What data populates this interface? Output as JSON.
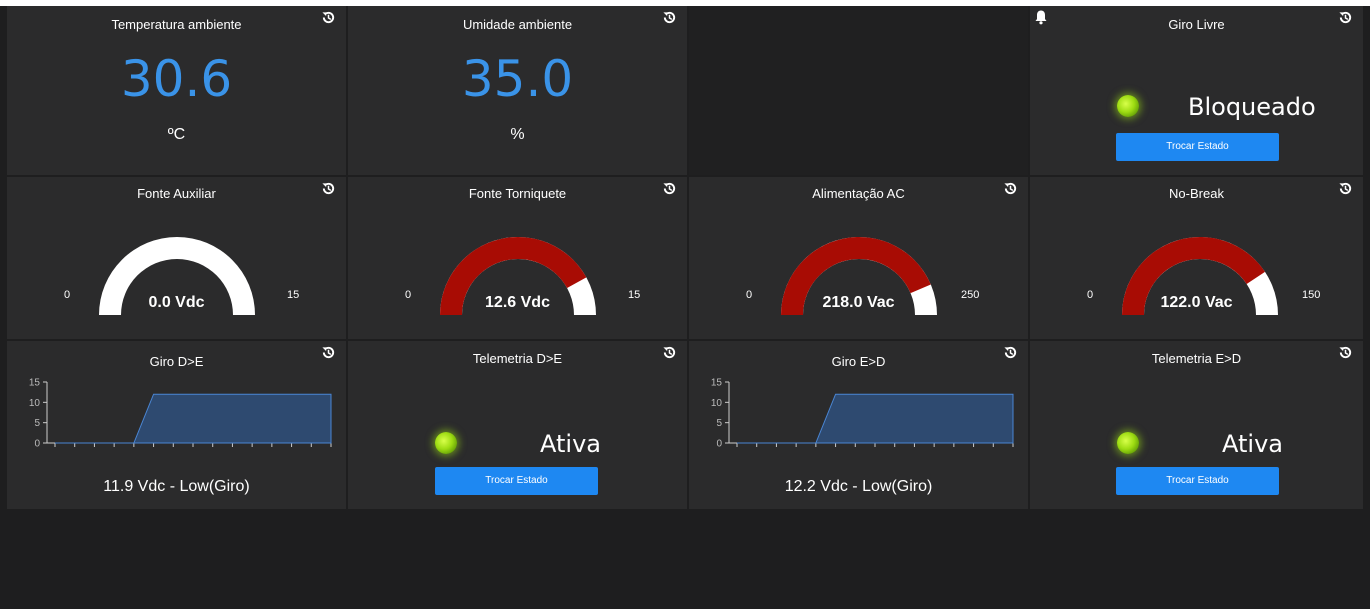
{
  "colors": {
    "value_blue": "#3a93e8",
    "gauge_red": "#a80c04",
    "gauge_track": "#ffffff",
    "led_green": "#9ddc12",
    "button_blue": "#1e88f2",
    "chart_fill": "#2e4a70",
    "chart_line": "#4a86d4"
  },
  "icons": {
    "history": "history-icon",
    "alarm": "bell-icon"
  },
  "tiles": {
    "temperatura": {
      "title": "Temperatura ambiente",
      "value": "30.6",
      "unit": "ºC"
    },
    "umidade": {
      "title": "Umidade ambiente",
      "value": "35.0",
      "unit": "%"
    },
    "giro_livre": {
      "title": "Giro Livre",
      "state": "Bloqueado",
      "button": "Trocar Estado"
    },
    "fonte_auxiliar": {
      "title": "Fonte Auxiliar",
      "min": "0",
      "max": "15",
      "value": 0.0,
      "value_label": "0.0 Vdc"
    },
    "fonte_torniquete": {
      "title": "Fonte Torniquete",
      "min": "0",
      "max": "15",
      "value": 12.6,
      "value_label": "12.6 Vdc"
    },
    "alimentacao_ac": {
      "title": "Alimentação AC",
      "min": "0",
      "max": "250",
      "value": 218.0,
      "value_label": "218.0 Vac"
    },
    "no_break": {
      "title": "No-Break",
      "min": "0",
      "max": "150",
      "value": 122.0,
      "value_label": "122.0 Vac"
    },
    "giro_de": {
      "title": "Giro D>E",
      "label": "11.9 Vdc - Low(Giro)"
    },
    "telemetria_de": {
      "title": "Telemetria D>E",
      "state": "Ativa",
      "button": "Trocar Estado"
    },
    "giro_ed": {
      "title": "Giro E>D",
      "label": "12.2 Vdc - Low(Giro)"
    },
    "telemetria_ed": {
      "title": "Telemetria E>D",
      "state": "Ativa",
      "button": "Trocar Estado"
    }
  },
  "chart_data": [
    {
      "type": "area",
      "ylim": [
        0,
        15
      ],
      "yticks": [
        "0",
        "5",
        "10",
        "15"
      ],
      "x": [
        0,
        1,
        2,
        3,
        4,
        5,
        6,
        7,
        8,
        9,
        10,
        11,
        12,
        13,
        14
      ],
      "values": [
        0,
        0,
        0,
        0,
        0,
        12,
        12,
        12,
        12,
        12,
        12,
        12,
        12,
        12,
        12
      ]
    },
    {
      "type": "area",
      "ylim": [
        0,
        15
      ],
      "yticks": [
        "0",
        "5",
        "10",
        "15"
      ],
      "x": [
        0,
        1,
        2,
        3,
        4,
        5,
        6,
        7,
        8,
        9,
        10,
        11,
        12,
        13,
        14
      ],
      "values": [
        0,
        0,
        0,
        0,
        0,
        12,
        12,
        12,
        12,
        12,
        12,
        12,
        12,
        12,
        12
      ]
    }
  ]
}
